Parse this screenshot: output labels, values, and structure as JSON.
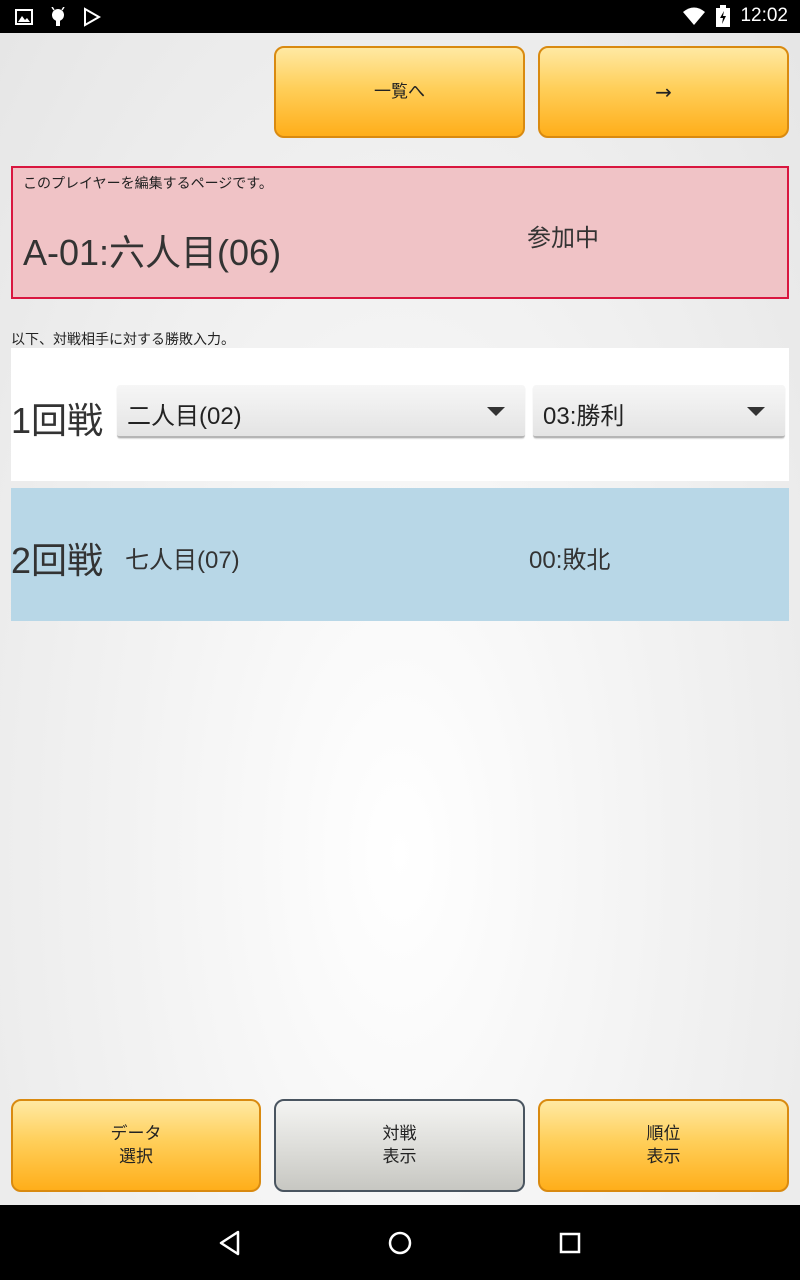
{
  "status_bar": {
    "time": "12:02",
    "icons": [
      "image-icon",
      "android-icon",
      "play-store-icon",
      "wifi-icon",
      "battery-icon"
    ]
  },
  "header": {
    "list_button_label": "一覧へ",
    "next_button_label": "→"
  },
  "player": {
    "note": "このプレイヤーを編集するページです。",
    "name": "A-01:六人目(06)",
    "status": "参加中"
  },
  "instruction": "以下、対戦相手に対する勝敗入力。",
  "rounds": [
    {
      "label": "1回戦",
      "opponent": "二人目(02)",
      "result": "03:勝利",
      "editable": true
    },
    {
      "label": "2回戦",
      "opponent": "七人目(07)",
      "result": "00:敗北",
      "editable": false
    }
  ],
  "footer": {
    "data_select_label": "データ\n選択",
    "match_view_label": "対戦\n表示",
    "ranking_view_label": "順位\n表示"
  },
  "colors": {
    "accent_orange": "#ffae1a",
    "player_box_bg": "#f0c3c6",
    "player_box_border": "#d9163f",
    "round2_bg": "#b8d7e7"
  },
  "nav": {
    "icons": [
      "back-icon",
      "home-icon",
      "recents-icon"
    ]
  }
}
